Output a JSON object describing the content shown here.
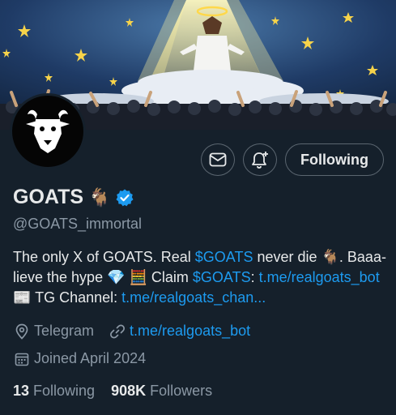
{
  "colors": {
    "background": "#15202b",
    "text_primary": "#e7e9ea",
    "text_secondary": "#8b98a5",
    "link": "#1d9bf0",
    "verified": "#1d9bf0"
  },
  "banner": {
    "icon": "goat-heaven-banner"
  },
  "avatar": {
    "icon": "goat-head-icon"
  },
  "actions": {
    "message_icon": "envelope-icon",
    "notify_icon": "bell-plus-icon",
    "follow_label": "Following"
  },
  "profile": {
    "display_name": "GOATS",
    "name_emoji": "🐐",
    "verified_icon": "verified-badge-icon",
    "handle": "@GOATS_immortal"
  },
  "bio": {
    "p1": "The only X of GOATS. Real ",
    "cashtag1": "$GOATS",
    "p2": " never die 🐐. Baaa-lieve the hype 💎 🧮 Claim ",
    "cashtag2": "$GOATS",
    "p3": ": ",
    "link1": "t.me/realgoats_bot",
    "p4": " 📰 TG Channel: ",
    "link2": "t.me/realgoats_chan..."
  },
  "meta": {
    "location": "Telegram",
    "location_icon": "location-pin-icon",
    "website": "t.me/realgoats_bot",
    "website_icon": "link-icon",
    "joined": "Joined April 2024",
    "joined_icon": "calendar-icon"
  },
  "stats": {
    "following_count": "13",
    "following_label": "Following",
    "followers_count": "908K",
    "followers_label": "Followers"
  }
}
